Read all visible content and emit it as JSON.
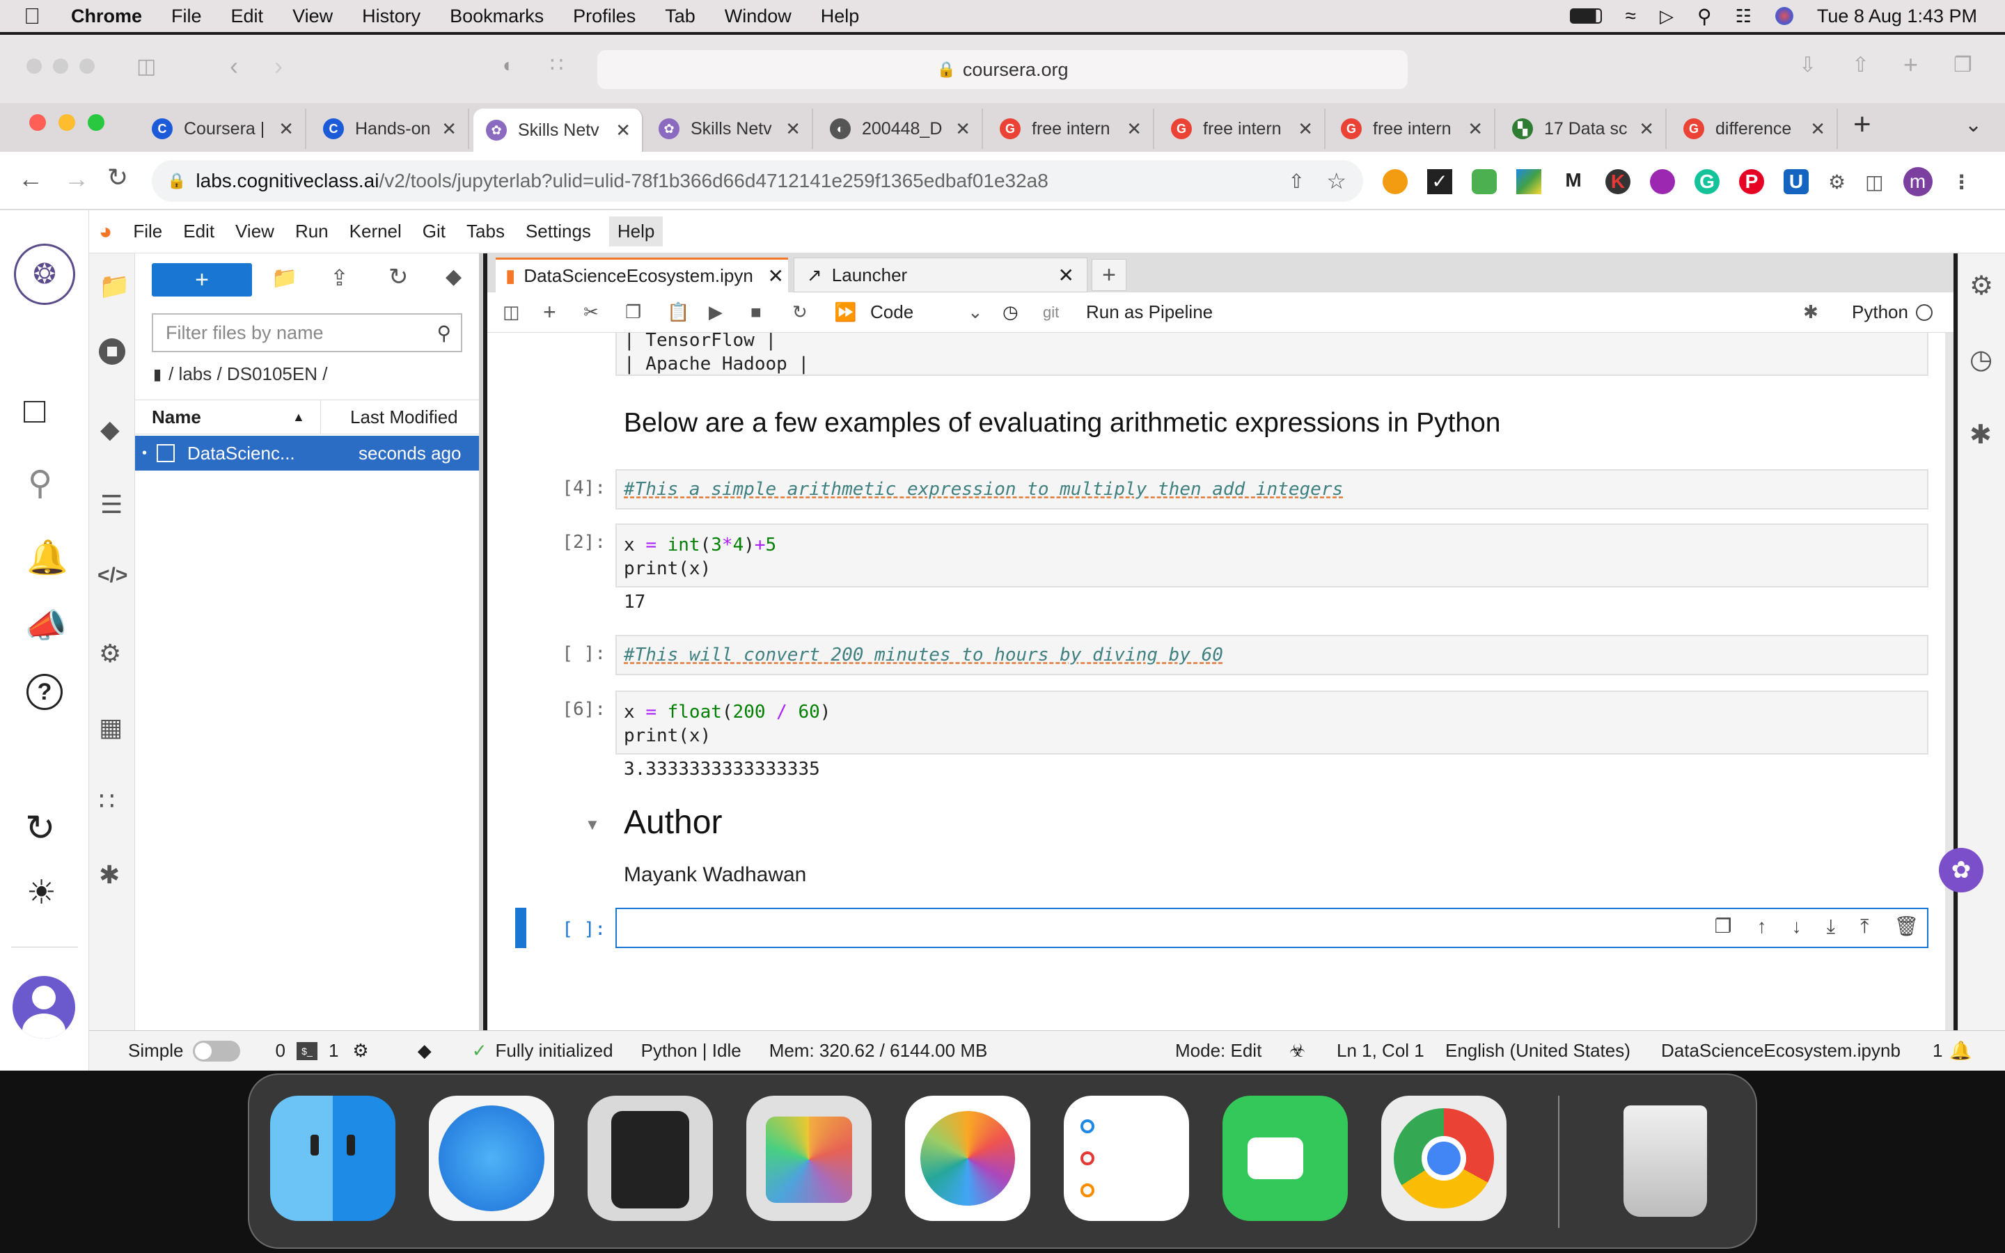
{
  "menubar": {
    "app": "Chrome",
    "items": [
      "File",
      "Edit",
      "View",
      "History",
      "Bookmarks",
      "Profiles",
      "Tab",
      "Window",
      "Help"
    ],
    "clock": "Tue 8 Aug  1:43 PM"
  },
  "outer_url": "coursera.org",
  "tabs": [
    {
      "label": "Coursera |",
      "favcolor": "#1c5bd8",
      "glyph": "C"
    },
    {
      "label": "Hands-on",
      "favcolor": "#1c5bd8",
      "glyph": "C"
    },
    {
      "label": "Skills Netv",
      "favcolor": "#8a6bbf",
      "glyph": "✿"
    },
    {
      "label": "Skills Netv",
      "favcolor": "#8a6bbf",
      "glyph": "✿"
    },
    {
      "label": "200448_D",
      "favcolor": "#555555",
      "glyph": "◐"
    },
    {
      "label": "free intern",
      "favcolor": "#ea4335",
      "glyph": "G"
    },
    {
      "label": "free intern",
      "favcolor": "#ea4335",
      "glyph": "G"
    },
    {
      "label": "free intern",
      "favcolor": "#ea4335",
      "glyph": "G"
    },
    {
      "label": "17 Data sc",
      "favcolor": "#2e7d32",
      "glyph": "▚"
    },
    {
      "label": "difference",
      "favcolor": "#ea4335",
      "glyph": "G"
    }
  ],
  "address": {
    "domain": "labs.cognitiveclass.ai",
    "path": "/v2/tools/jupyterlab?ulid=ulid-78f1b366d66d4712141e259f1365edbaf01e32a8"
  },
  "profile_initial": "m",
  "jupyter_menu": [
    "File",
    "Edit",
    "View",
    "Run",
    "Kernel",
    "Git",
    "Tabs",
    "Settings",
    "Help"
  ],
  "filebrowser": {
    "new_label": "+",
    "filter_placeholder": "Filter files by name",
    "breadcrumb": "/ labs / DS0105EN /",
    "col_name": "Name",
    "col_modified": "Last Modified",
    "file_name": "DataScienc...",
    "file_modified": "seconds ago"
  },
  "doc_tabs": [
    {
      "label": "DataScienceEcosystem.ipyn"
    },
    {
      "label": "Launcher"
    }
  ],
  "toolbar": {
    "celltype": "Code",
    "git": "git",
    "pipeline": "Run as Pipeline",
    "kernel": "Python"
  },
  "notebook": {
    "table_rows": [
      "| TensorFlow |",
      "| Apache Hadoop |"
    ],
    "heading": "Below are a few examples of evaluating arithmetic expressions in Python",
    "cell1": {
      "prompt": "[4]:",
      "code": "#This a simple arithmetic expression to multiply then add integers"
    },
    "cell2": {
      "prompt": "[2]:",
      "line1_a": "x ",
      "line1_eq": "=",
      "line1_fn": " int",
      "line1_b": "(",
      "line1_n1": "3",
      "line1_op": "*",
      "line1_n2": "4",
      "line1_c": ")",
      "line1_op2": "+",
      "line1_n3": "5",
      "line2": "print(x)",
      "output": "17"
    },
    "cell3": {
      "prompt": "[ ]:",
      "code": "#This will convert 200 minutes to hours by diving by 60"
    },
    "cell4": {
      "prompt": "[6]:",
      "line1_a": "x ",
      "line1_eq": "=",
      "line1_fn": " float",
      "line1_b": "(",
      "line1_n1": "200",
      "line1_op": " / ",
      "line1_n2": "60",
      "line1_c": ")",
      "line2": "print(x)",
      "output": "3.3333333333333335"
    },
    "author_heading": "Author",
    "author_name": "Mayank Wadhawan",
    "active_prompt": "[ ]:"
  },
  "status": {
    "mode_simple": "Simple",
    "count0": "0",
    "count1": "1",
    "initialized": "Fully initialized",
    "kernel": "Python | Idle",
    "mem": "Mem: 320.62 / 6144.00 MB",
    "edit_mode": "Mode: Edit",
    "position": "Ln 1, Col 1",
    "language": "English (United States)",
    "filename": "DataScienceEcosystem.ipynb",
    "notif_count": "1"
  },
  "colors": {
    "accent": "#1976d2",
    "selected": "#2b6cc4",
    "tabbar": "#dedadb"
  }
}
